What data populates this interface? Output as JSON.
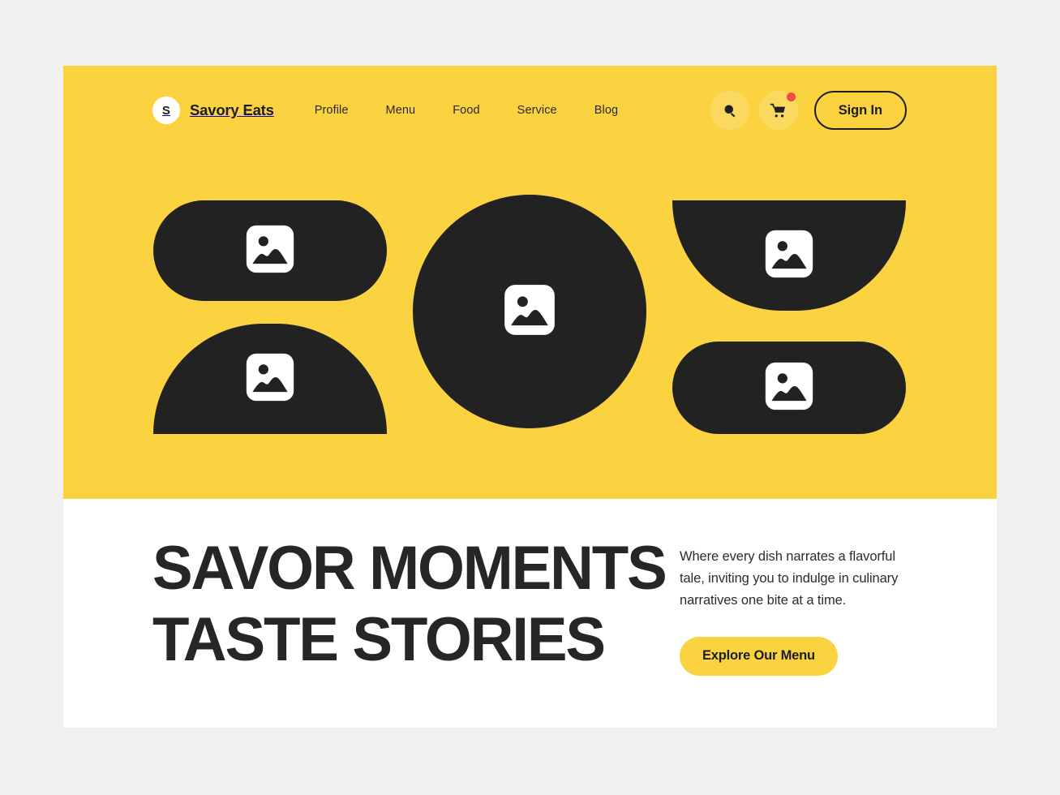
{
  "theme": {
    "page_background": "#f0f0f0",
    "hero_yellow": "#FBD240",
    "dark": "#222222",
    "white": "#ffffff",
    "notification_red": "#EF4B4B",
    "text_dark": "#262626"
  },
  "header": {
    "brand": {
      "initial": "S",
      "name": "Savory Eats"
    },
    "nav_items": [
      {
        "label": "Profile"
      },
      {
        "label": "Menu"
      },
      {
        "label": "Food"
      },
      {
        "label": "Service"
      },
      {
        "label": "Blog"
      }
    ],
    "actions": {
      "search_icon": "search-icon",
      "cart_icon": "shopping-cart-icon",
      "cart_has_notification": true,
      "sign_in_label": "Sign In"
    }
  },
  "hero": {
    "shapes": [
      {
        "name": "image-placeholder-top-left",
        "form": "pill",
        "icon": "image-placeholder-icon"
      },
      {
        "name": "image-placeholder-bottom-left",
        "form": "dome-up",
        "icon": "image-placeholder-icon"
      },
      {
        "name": "image-placeholder-center",
        "form": "circle",
        "icon": "image-placeholder-icon"
      },
      {
        "name": "image-placeholder-top-right",
        "form": "dome-down",
        "icon": "image-placeholder-icon"
      },
      {
        "name": "image-placeholder-bottom-right",
        "form": "pill",
        "icon": "image-placeholder-icon"
      }
    ]
  },
  "main": {
    "headline_line_1": "SAVOR MOMENTS",
    "headline_line_2": "TASTE STORIES",
    "description": "Where every dish narrates a flavorful tale, inviting you to indulge in culinary narratives one bite at a time.",
    "cta_label": "Explore Our Menu"
  }
}
